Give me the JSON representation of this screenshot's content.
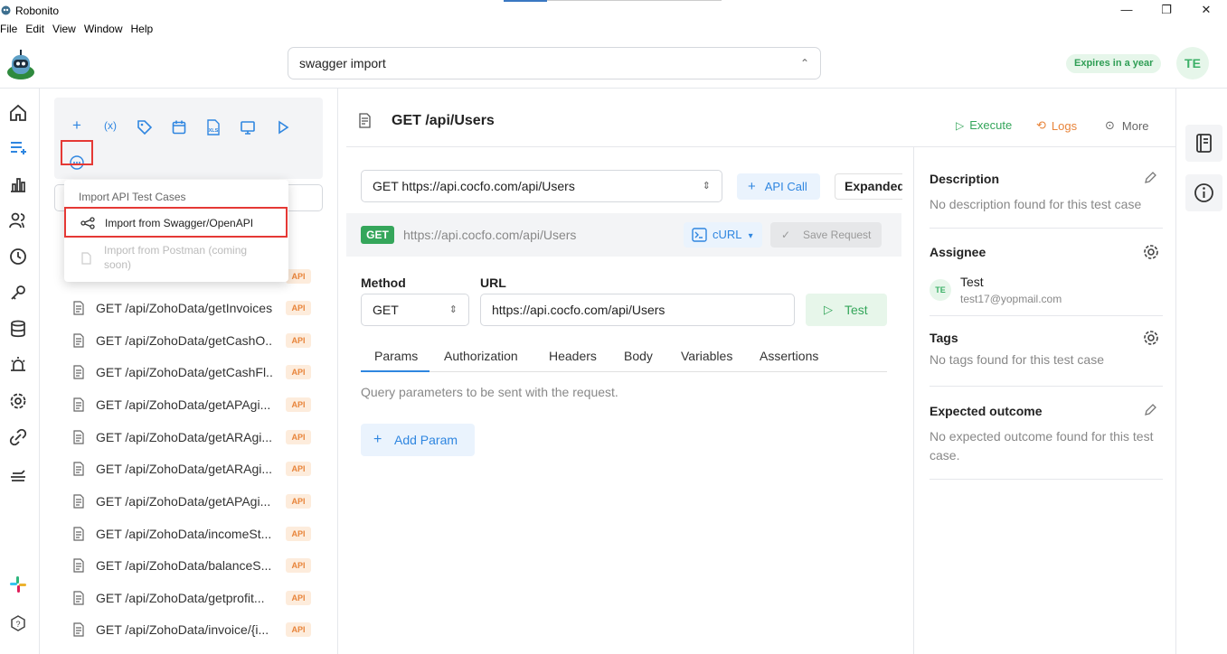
{
  "window": {
    "title": "Robonito",
    "controls": [
      "minimize",
      "maximize",
      "close"
    ]
  },
  "menu": [
    "File",
    "Edit",
    "View",
    "Window",
    "Help"
  ],
  "header": {
    "project_select": "swagger import",
    "expires_badge": "Expires in a year",
    "avatar_initials": "TE"
  },
  "toolbar": {
    "icons": [
      "add-icon",
      "variable-icon",
      "tag-icon",
      "calendar-icon",
      "xls-icon",
      "monitor-icon",
      "play-icon",
      "more-icon"
    ]
  },
  "import_menu": {
    "header": "Import API Test Cases",
    "swagger": "Import from Swagger/OpenAPI",
    "postman": "Import from Postman (coming soon)"
  },
  "test_list": {
    "badge": "API",
    "items": [
      "GET /api/ZohoData/getInvoices",
      "GET /api/ZohoData/getCashO...",
      "GET /api/ZohoData/getCashFl...",
      "GET /api/ZohoData/getAPAgi...",
      "GET /api/ZohoData/getARAgi...",
      "GET /api/ZohoData/getARAgi...",
      "GET /api/ZohoData/getAPAgi...",
      "GET /api/ZohoData/incomeSt...",
      "GET /api/ZohoData/balanceS...",
      "GET /api/ZohoData/getprofit...",
      "GET /api/ZohoData/invoice/{i..."
    ]
  },
  "detail": {
    "title": "GET /api/Users",
    "actions": {
      "execute": "Execute",
      "logs": "Logs",
      "more": "More"
    },
    "request_select": "GET https://api.cocfo.com/api/Users",
    "api_call": "API Call",
    "expanded": "Expanded",
    "method_badge": "GET",
    "strip_url": "https://api.cocfo.com/api/Users",
    "curl": "cURL",
    "save_request": "Save Request",
    "method_label": "Method",
    "url_label": "URL",
    "method_value": "GET",
    "url_value": "https://api.cocfo.com/api/Users",
    "test": "Test",
    "tabs": [
      "Params",
      "Authorization",
      "Headers",
      "Body",
      "Variables",
      "Assertions"
    ],
    "active_tab": "Params",
    "query_hint": "Query parameters to be sent with the request.",
    "add_param": "Add Param"
  },
  "info": {
    "description_title": "Description",
    "description_text": "No description found for this test case",
    "assignee_title": "Assignee",
    "assignee_initials": "TE",
    "assignee_name": "Test",
    "assignee_email": "test17@yopmail.com",
    "tags_title": "Tags",
    "tags_text": "No tags found for this test case",
    "outcome_title": "Expected outcome",
    "outcome_text": "No expected outcome found for this test case."
  },
  "colors": {
    "accent": "#2f86e0",
    "success": "#35a65b",
    "warning": "#e8843a",
    "highlight": "#e53935"
  }
}
